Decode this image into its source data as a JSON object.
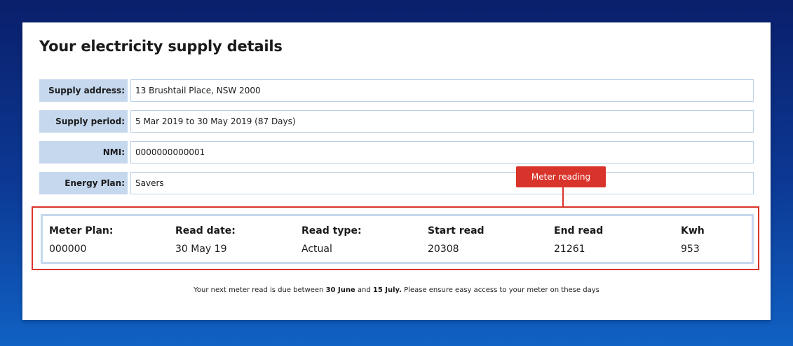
{
  "title": "Your electricity supply details",
  "details": [
    {
      "label": "Supply address:",
      "value": "13 Brushtail Place, NSW 2000"
    },
    {
      "label": "Supply period:",
      "value": "5 Mar 2019 to 30 May 2019  (87 Days)"
    },
    {
      "label": "NMI:",
      "value": "0000000000001"
    },
    {
      "label": "Energy Plan:",
      "value": "Savers"
    }
  ],
  "callout": {
    "label": "Meter reading",
    "color": "#d9342b"
  },
  "meter": {
    "headers": [
      "Meter Plan:",
      "Read date:",
      "Read type:",
      "Start read",
      "End read",
      "Kwh"
    ],
    "values": [
      "000000",
      "30 May 19",
      "Actual",
      "20308",
      "21261",
      "953"
    ]
  },
  "footnote": {
    "prefix": "Your next meter read is due between ",
    "date_start": "30 June",
    "middle": " and ",
    "date_end": "15 July.",
    "suffix": " Please ensure easy access to your meter on these days"
  },
  "colors": {
    "label_bg": "#c5d8ee",
    "accent_red": "#d9342b",
    "background_top": "#0a1f6b",
    "background_bottom": "#1062c4"
  }
}
